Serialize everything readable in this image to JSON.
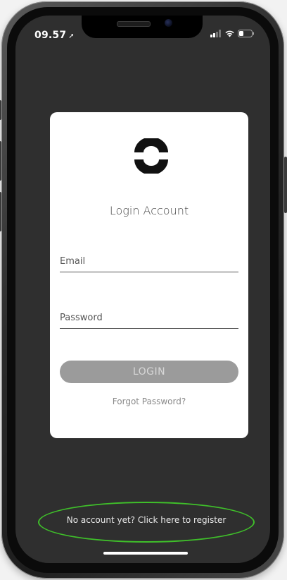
{
  "status_bar": {
    "time": "09.57",
    "location_icon": "location-arrow-icon",
    "signal_icon": "signal-icon",
    "wifi_icon": "wifi-icon",
    "battery_icon": "battery-icon"
  },
  "login_card": {
    "logo_icon": "app-logo-icon",
    "title": "Login Account",
    "email_label": "Email",
    "password_label": "Password",
    "login_button": "LOGIN",
    "forgot_password": "Forgot Password?"
  },
  "footer": {
    "register_text": "No account yet? Click here to register",
    "highlight_color": "#3fbf2a"
  }
}
